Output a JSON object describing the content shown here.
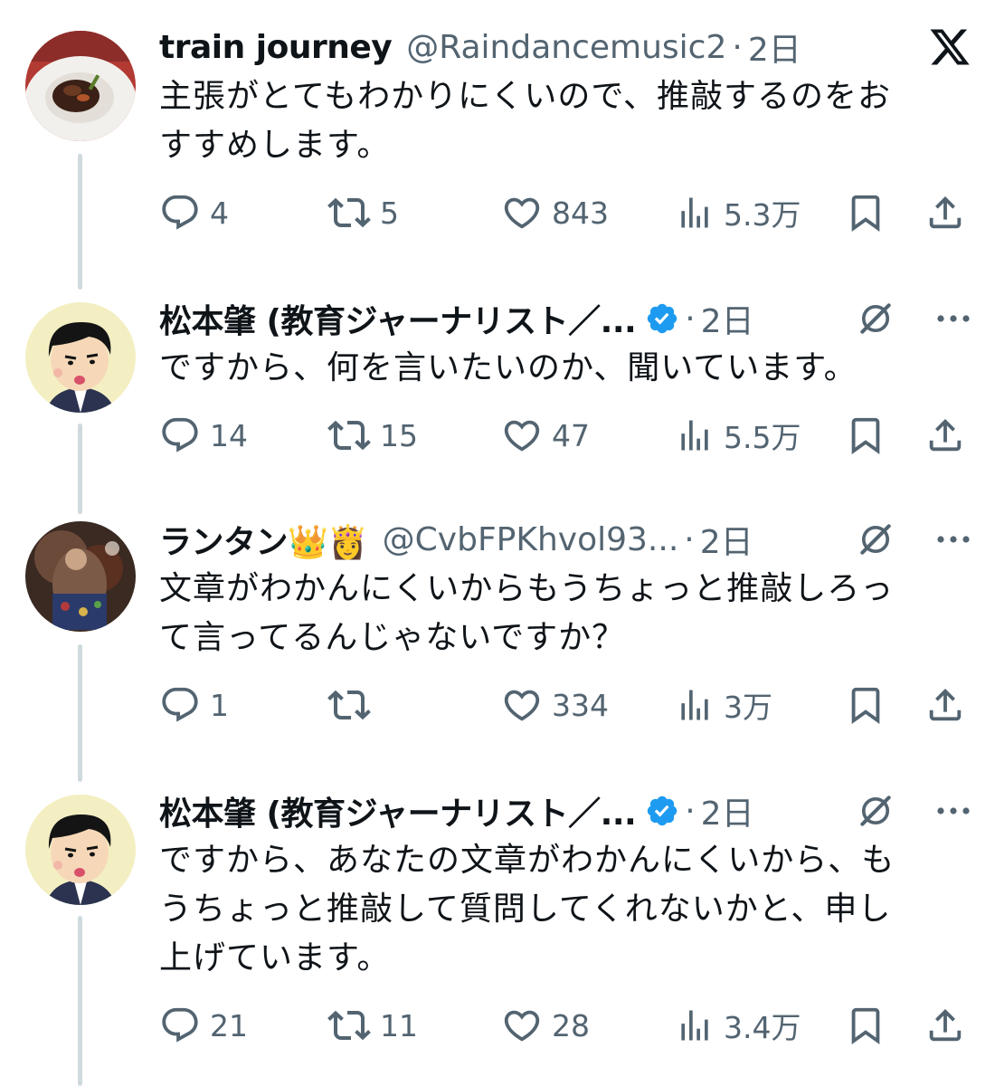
{
  "app": {
    "logo": "x-logo"
  },
  "tweets": [
    {
      "name": "train journey",
      "handle": "@Raindancemusic2",
      "dot": "·",
      "time": "2日",
      "text_lines": [
        "主張がとてもわかりにくいので、推敲するのをお",
        "すすめします。"
      ],
      "replies": "4",
      "retweets": "5",
      "likes": "843",
      "views": "5.3万",
      "avatar": "food-plate-avatar"
    },
    {
      "name": "松本肇 (教育ジャーナリスト／...",
      "verified": true,
      "dot": "·",
      "time": "2日",
      "text_lines": [
        "ですから、何を言いたいのか、聞いています。"
      ],
      "replies": "14",
      "retweets": "15",
      "likes": "47",
      "views": "5.5万",
      "avatar": "cartoon-man-avatar"
    },
    {
      "name": "ランタン👑👸",
      "handle": "@CvbFPKhvol93...",
      "dot": "·",
      "time": "2日",
      "text_lines": [
        "文章がわかんにくいからもうちょっと推敲しろっ",
        "て言ってるんじゃないですか？"
      ],
      "replies": "1",
      "retweets": "",
      "likes": "334",
      "views": "3万",
      "avatar": "artwork-avatar"
    },
    {
      "name": "松本肇 (教育ジャーナリスト／...",
      "verified": true,
      "dot": "·",
      "time": "2日",
      "text_lines": [
        "ですから、あなたの文章がわかんにくいから、も",
        "うちょっと推敲して質問してくれないかと、申し",
        "上げています。"
      ],
      "replies": "21",
      "retweets": "11",
      "likes": "28",
      "views": "3.4万",
      "avatar": "cartoon-man-avatar"
    }
  ],
  "colors": {
    "text": "#0f1419",
    "secondary": "#536471",
    "verified": "#1d9bf0",
    "thread_line": "#cfd9de"
  }
}
